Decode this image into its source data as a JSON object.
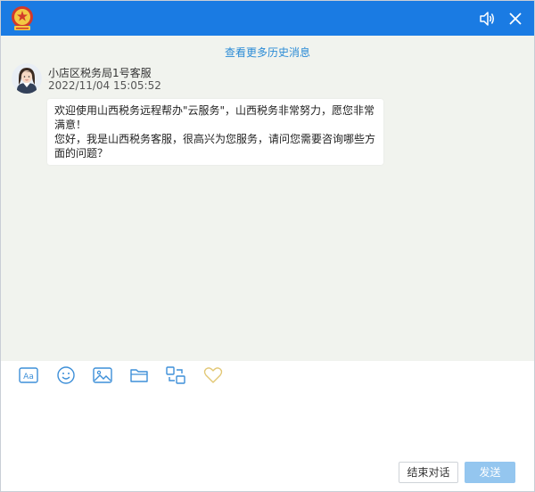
{
  "titlebar": {
    "logo_icon": "tax-bureau-emblem-icon",
    "volume_icon": "speaker-icon",
    "close_icon": "close-icon",
    "bg_color": "#1a7be3"
  },
  "chat": {
    "history_link": "查看更多历史消息",
    "messages": [
      {
        "sender": "小店区税务局1号客服",
        "time": "2022/11/04 15:05:52",
        "text": "欢迎使用山西税务远程帮办\"云服务\"，山西税务非常努力，愿您非常满意！\n您好，我是山西税务客服，很高兴为您服务，请问您需要咨询哪些方面的问题？"
      }
    ]
  },
  "toolbar": {
    "tools": [
      {
        "icon": "font-aa-icon"
      },
      {
        "icon": "emoji-icon"
      },
      {
        "icon": "image-icon"
      },
      {
        "icon": "folder-icon"
      },
      {
        "icon": "screen-share-icon"
      },
      {
        "icon": "heart-icon"
      }
    ]
  },
  "input": {
    "value": ""
  },
  "buttons": {
    "end": "结束对话",
    "send": "发送"
  }
}
